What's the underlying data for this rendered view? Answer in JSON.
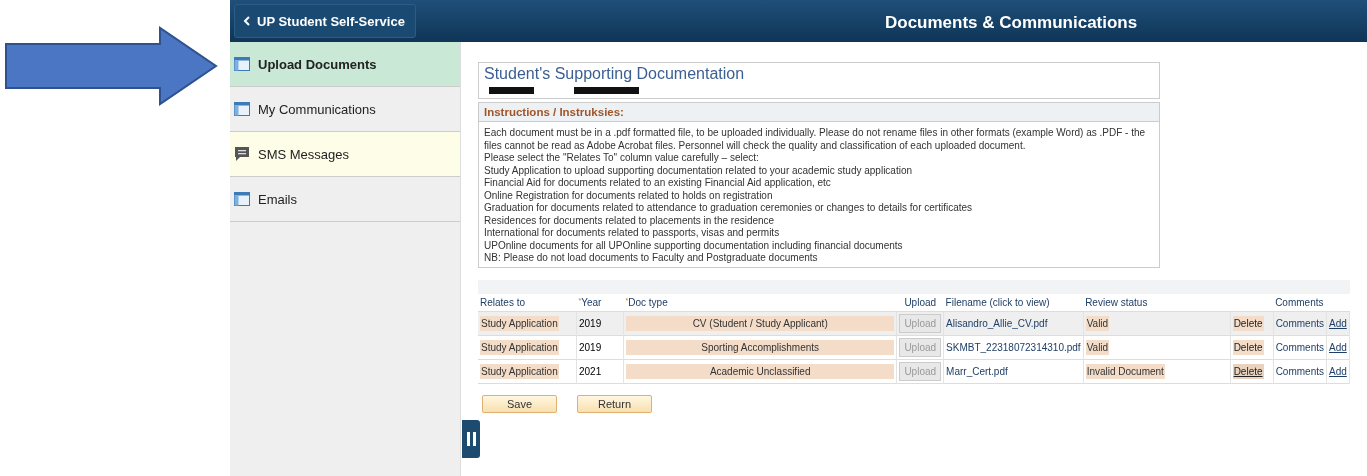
{
  "header": {
    "back_button": "UP Student Self-Service",
    "title": "Documents & Communications"
  },
  "sidebar": {
    "items": [
      {
        "label": "Upload Documents",
        "kind": "page",
        "selected": true
      },
      {
        "label": "My Communications",
        "kind": "page",
        "selected": false
      },
      {
        "label": "SMS Messages",
        "kind": "chat",
        "selected": false
      },
      {
        "label": "Emails",
        "kind": "page",
        "selected": false
      }
    ]
  },
  "panel": {
    "title": "Student's Supporting Documentation",
    "instructions_heading": "Instructions / Instruksies:",
    "instructions": [
      "Each document must be in a .pdf formatted file, to be uploaded individually. Please do not rename files in other formats (example Word) as .PDF - the files cannot be read as Adobe Acrobat files. Personnel will check the quality and classification of each uploaded document.",
      "Please select the \"Relates To\" column value carefully – select:",
      "Study Application to upload supporting documentation related to your academic study application",
      "Financial Aid for documents related to an existing Financial Aid application, etc",
      "Online Registration for documents related to holds on registration",
      "Graduation for documents related to attendance to graduation ceremonies or changes to details for certificates",
      "Residences for documents related to placements in the residence",
      "International for documents related to passports, visas and permits",
      "UPOnline documents for all UPOnline supporting documentation including financial documents",
      "NB: Please do not load documents to Faculty and Postgraduate documents"
    ]
  },
  "table": {
    "columns": [
      {
        "label": "Relates to"
      },
      {
        "label": "Year",
        "marker": "*"
      },
      {
        "label": "Doc type",
        "marker": "*"
      },
      {
        "label": "Upload"
      },
      {
        "label": "Filename (click to view)"
      },
      {
        "label": "Review status"
      },
      {
        "label": "Comments"
      }
    ],
    "rows": [
      {
        "relates_to": "Study Application",
        "year": "2019",
        "doc_type": "CV (Student / Study Applicant)",
        "upload": "Upload",
        "filename": "Alisandro_Allie_CV.pdf",
        "review_status": "Valid",
        "delete": "Delete",
        "delete_focused": false,
        "comments": "Comments",
        "add": "Add",
        "selected": true
      },
      {
        "relates_to": "Study Application",
        "year": "2019",
        "doc_type": "Sporting Accomplishments",
        "upload": "Upload",
        "filename": "SKMBT_22318072314310.pdf",
        "review_status": "Valid",
        "delete": "Delete",
        "delete_focused": false,
        "comments": "Comments",
        "add": "Add",
        "selected": false
      },
      {
        "relates_to": "Study Application",
        "year": "2021",
        "doc_type": "Academic Unclassified",
        "upload": "Upload",
        "filename": "Marr_Cert.pdf",
        "review_status": "Invalid Document",
        "delete": "Delete",
        "delete_focused": true,
        "comments": "Comments",
        "add": "Add",
        "selected": false
      }
    ]
  },
  "buttons": [
    "Save",
    "Return"
  ]
}
